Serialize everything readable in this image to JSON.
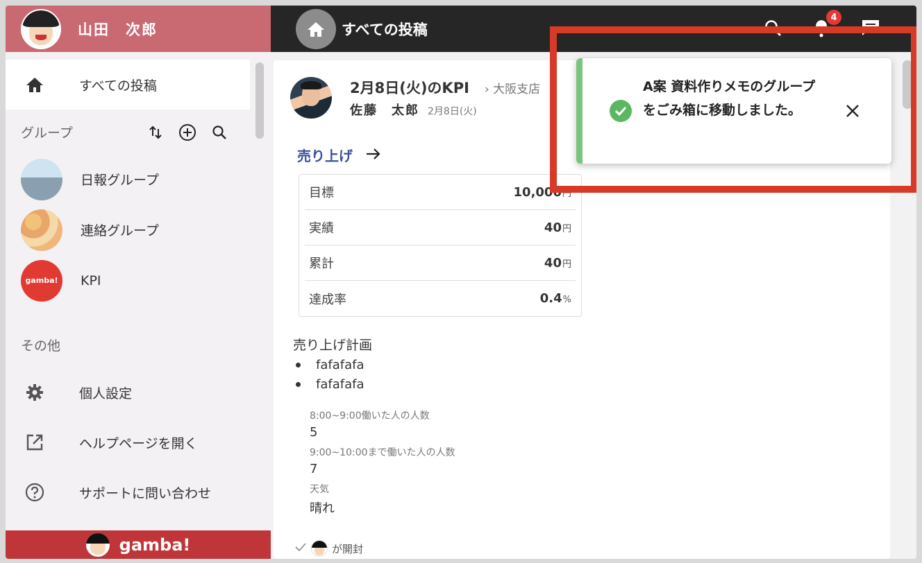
{
  "user": {
    "name": "山田　次郎"
  },
  "topbar": {
    "title": "すべての投稿",
    "notification_count": "4"
  },
  "nav": {
    "all_posts": "すべての投稿"
  },
  "groups": {
    "heading": "グループ",
    "items": [
      {
        "label": "日報グループ"
      },
      {
        "label": "連絡グループ"
      },
      {
        "label": "KPI",
        "logo_text": "gamba!"
      }
    ]
  },
  "other": {
    "heading": "その他",
    "items": [
      {
        "label": "個人設定",
        "icon": "gear-icon"
      },
      {
        "label": "ヘルプページを開く",
        "icon": "open-external-icon"
      },
      {
        "label": "サポートに問い合わせ",
        "icon": "help-circle-icon"
      }
    ]
  },
  "brand": {
    "text": "gamba!"
  },
  "post": {
    "title": "2月8日(火)のKPI",
    "branch": "大阪支店",
    "author": "佐藤　太郎",
    "date": "2月8日(火)",
    "sales_link": "売り上げ",
    "kpi": [
      {
        "label": "目標",
        "value": "10,000",
        "unit": "円"
      },
      {
        "label": "実績",
        "value": "40",
        "unit": "円"
      },
      {
        "label": "累計",
        "value": "40",
        "unit": "円"
      },
      {
        "label": "達成率",
        "value": "0.4",
        "unit": "%"
      }
    ],
    "plan_title": "売り上げ計画",
    "plan_items": [
      "fafafafa",
      "fafafafa"
    ],
    "fields": [
      {
        "label": "8:00~9:00働いた人の人数",
        "value": "5"
      },
      {
        "label": "9:00~10:00まで働いた人の人数",
        "value": "7"
      },
      {
        "label": "天気",
        "value": "晴れ"
      }
    ],
    "opened_text": "が開封"
  },
  "toast": {
    "message": "A案 資料作りメモのグループをごみ箱に移動しました。",
    "accent_color": "#7ac57d"
  },
  "colors": {
    "user_bar": "#c96a72",
    "topbar": "#262626",
    "brand_bar": "#c0353a",
    "link": "#3a4fa0",
    "highlight": "#d83a28"
  }
}
